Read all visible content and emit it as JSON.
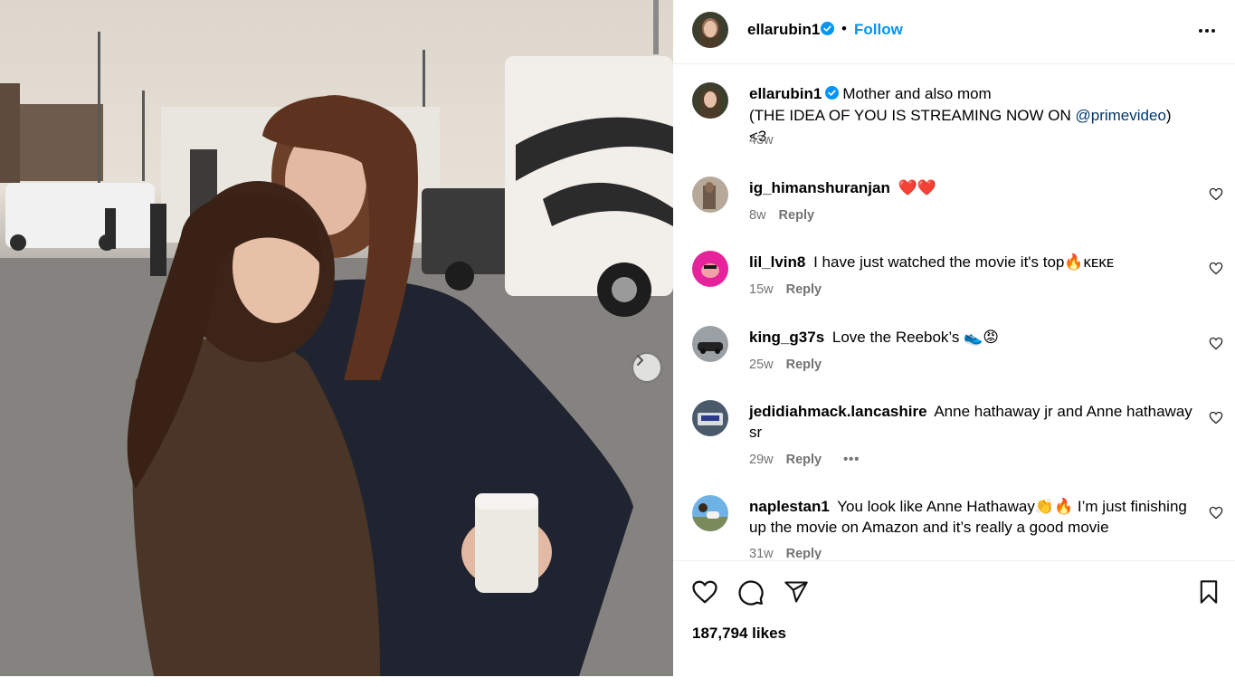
{
  "post": {
    "username": "ellarubin1",
    "follow_label": "Follow",
    "dot": "•",
    "more_icon": "more-horizontal-icon",
    "verified_icon": "verified-badge-icon",
    "caption": {
      "username": "ellarubin1",
      "line1": "Mother and also mom",
      "line2_prefix": "(THE IDEA OF YOU IS STREAMING NOW ON ",
      "mention": "@primevideo",
      "line2_suffix": ") <3",
      "time": "43w"
    },
    "likes": "187,794 likes"
  },
  "comments": [
    {
      "username": "ig_himanshuranjan",
      "text": "❤️❤️",
      "time": "8w",
      "reply": "Reply"
    },
    {
      "username": "lil_lvin8",
      "text": "I have just watched the movie it's top🔥ᴋᴇᴋᴇ",
      "time": "15w",
      "reply": "Reply"
    },
    {
      "username": "king_g37s",
      "text": "Love the Reebok’s 👟😡",
      "time": "25w",
      "reply": "Reply"
    },
    {
      "username": "jedidiahmack.lancashire",
      "text": "Anne hathaway jr and Anne hathaway sr",
      "time": "29w",
      "reply": "Reply",
      "more": "•••"
    },
    {
      "username": "naplestan1",
      "text": "You look like Anne Hathaway👏🔥 I’m just finishing up the movie on Amazon and it’s really a good movie",
      "time": "31w",
      "reply": "Reply"
    }
  ],
  "icons": {
    "like": "heart-icon",
    "comment": "comment-icon",
    "share": "send-icon",
    "save": "bookmark-icon",
    "next": "chevron-right-icon"
  },
  "colors": {
    "follow": "#0095f6",
    "verified": "#0095f6",
    "muted": "#737373",
    "mention": "#00376b"
  }
}
